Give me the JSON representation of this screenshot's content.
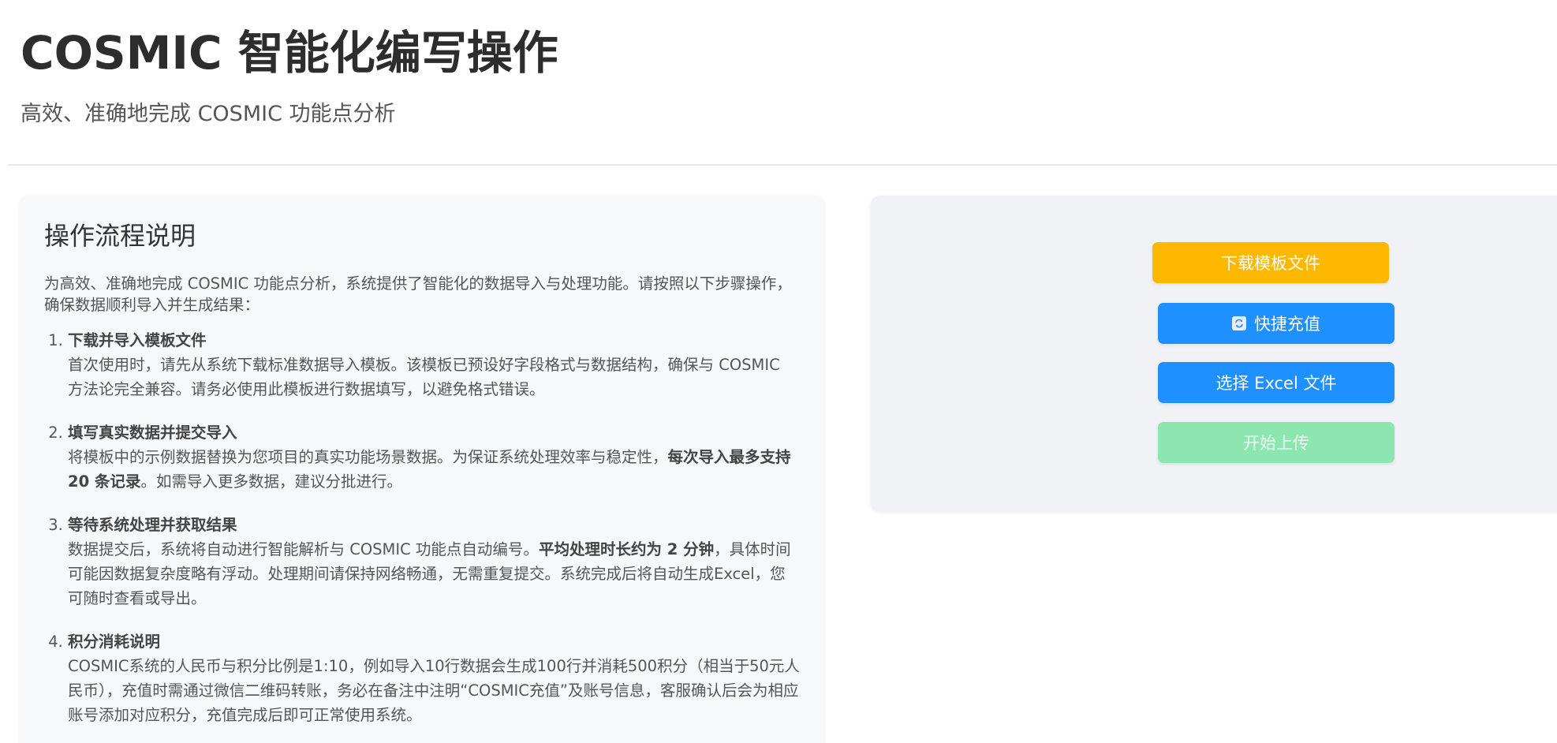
{
  "header": {
    "title": "COSMIC 智能化编写操作",
    "subtitle": "高效、准确地完成 COSMIC 功能点分析"
  },
  "guide": {
    "heading": "操作流程说明",
    "intro": "为高效、准确地完成 COSMIC 功能点分析，系统提供了智能化的数据导入与处理功能。请按照以下步骤操作，确保数据顺利导入并生成结果：",
    "steps": [
      {
        "title": "下载并导入模板文件",
        "desc": "首次使用时，请先从系统下载标准数据导入模板。该模板已预设好字段格式与数据结构，确保与 COSMIC 方法论完全兼容。请务必使用此模板进行数据填写，以避免格式错误。"
      },
      {
        "title": "填写真实数据并提交导入",
        "desc_before": "将模板中的示例数据替换为您项目的真实功能场景数据。为保证系统处理效率与稳定性，",
        "desc_bold": "每次导入最多支持 20 条记录",
        "desc_after": "。如需导入更多数据，建议分批进行。"
      },
      {
        "title": "等待系统处理并获取结果",
        "desc_before": "数据提交后，系统将自动进行智能解析与 COSMIC 功能点自动编号。",
        "desc_bold": "平均处理时长约为 2 分钟",
        "desc_after": "，具体时间可能因数据复杂度略有浮动。处理期间请保持网络畅通，无需重复提交。系统完成后将自动生成Excel，您可随时查看或导出。"
      },
      {
        "title": "积分消耗说明",
        "desc": "COSMIC系统的人民币与积分比例是1:10，例如导入10行数据会生成100行并消耗500积分（相当于50元人民币），充值时需通过微信二维码转账，务必在备注中注明“COSMIC充值”及账号信息，客服确认后会为相应账号添加对应积分，充值完成后即可正常使用系统。"
      }
    ]
  },
  "actions": {
    "download_label": "下载模板文件",
    "recharge_label": "快捷充值",
    "recharge_icon": "sync-icon",
    "select_label": "选择 Excel 文件",
    "upload_label": "开始上传"
  },
  "colors": {
    "download": "#ffb800",
    "primary": "#1e90ff",
    "upload_disabled": "#8de6b0"
  }
}
